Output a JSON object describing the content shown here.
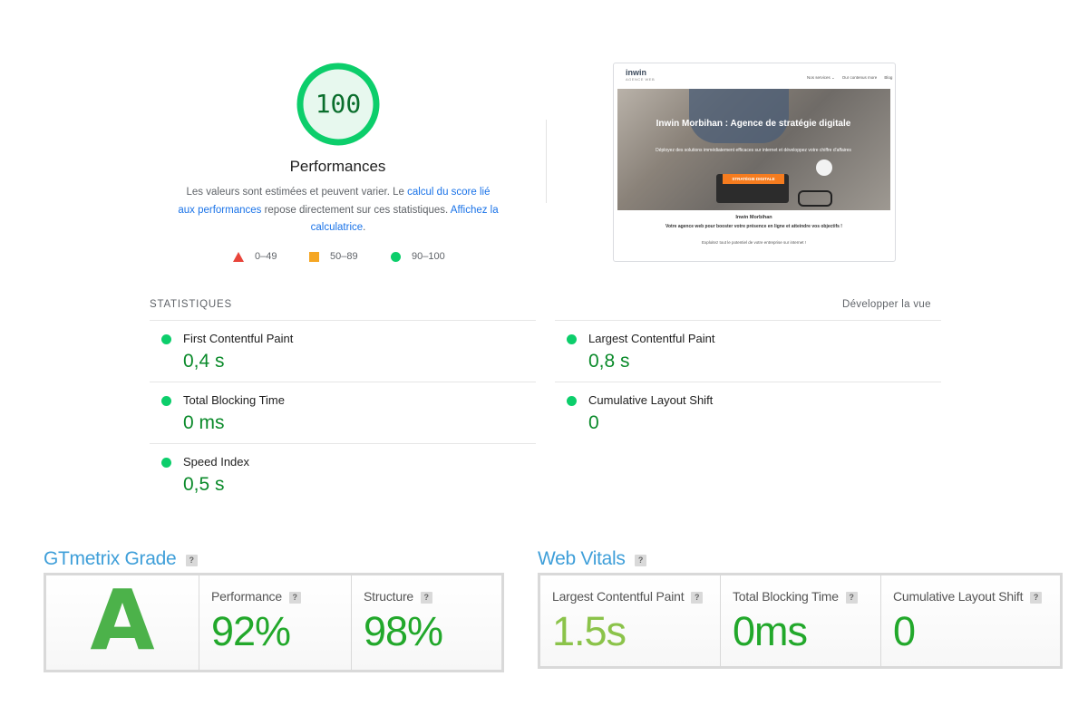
{
  "lighthouse": {
    "score": "100",
    "score_fraction": 1.0,
    "title": "Performances",
    "description": {
      "part1": "Les valeurs sont estimées et peuvent varier. Le ",
      "link1": "calcul du score lié aux performances",
      "part2": " repose directement sur ces statistiques. ",
      "link2": "Affichez la calculatrice",
      "part3": "."
    },
    "legend": [
      {
        "range": "0–49",
        "shape": "triangle",
        "color": "#e8443a"
      },
      {
        "range": "50–89",
        "shape": "square",
        "color": "#f5a623"
      },
      {
        "range": "90–100",
        "shape": "circle",
        "color": "#0cce6b"
      }
    ],
    "colors": {
      "pass": "#0cce6b",
      "pass_text": "#0a8a2a",
      "link": "#1a73e8"
    }
  },
  "screenshot_preview": {
    "logo": "inwin",
    "logo_sub": "AGENCE WEB",
    "nav": [
      "Nos services ⌄",
      "Our contenus more",
      "Blog"
    ],
    "hero_title": "Inwin Morbihan : Agence de stratégie digitale",
    "hero_sub": "Déployez des solutions immédiatement efficaces sur internet et développez votre chiffre d'affaires",
    "hero_button": "STRATÉGIE DIGITALE",
    "text1": "Inwin Morbihan",
    "text2": "Votre agence web pour booster votre présence en ligne et atteindre vos objectifs !",
    "text3": "Exploitez tout le potentiel de votre entreprise sur internet !"
  },
  "statistics": {
    "heading": "STATISTIQUES",
    "expand_label": "Développer la vue",
    "metrics": [
      {
        "name": "First Contentful Paint",
        "value": "0,4 s"
      },
      {
        "name": "Largest Contentful Paint",
        "value": "0,8 s"
      },
      {
        "name": "Total Blocking Time",
        "value": "0 ms"
      },
      {
        "name": "Cumulative Layout Shift",
        "value": "0"
      },
      {
        "name": "Speed Index",
        "value": "0,5 s"
      }
    ]
  },
  "gtmetrix": {
    "title": "GTmetrix Grade",
    "help": "?",
    "grade": "A",
    "performance_label": "Performance",
    "performance_value": "92%",
    "structure_label": "Structure",
    "structure_value": "98%"
  },
  "web_vitals": {
    "title": "Web Vitals",
    "help": "?",
    "items": [
      {
        "label": "Largest Contentful Paint",
        "value": "1.5s",
        "color": "#8bc34a"
      },
      {
        "label": "Total Blocking Time",
        "value": "0ms",
        "color": "#22a82b"
      },
      {
        "label": "Cumulative Layout Shift",
        "value": "0",
        "color": "#22a82b"
      }
    ]
  }
}
